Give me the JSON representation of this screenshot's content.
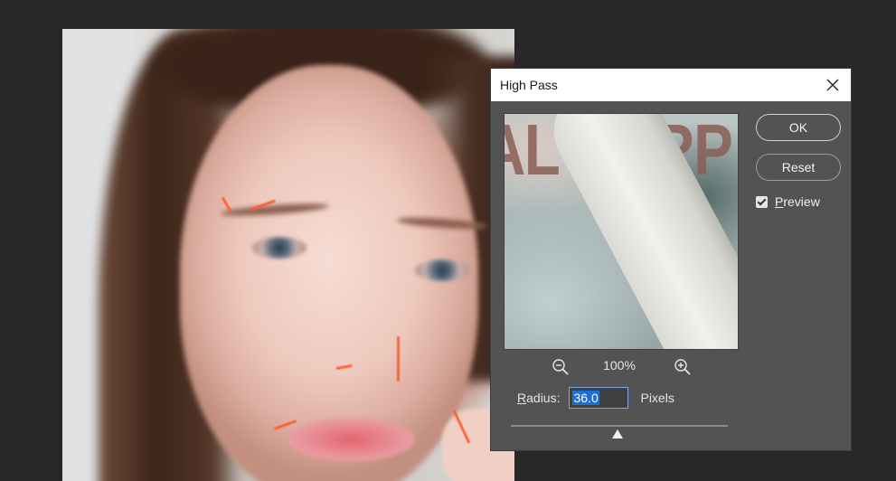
{
  "dialog": {
    "title": "High Pass",
    "close_icon": "close-icon",
    "preview_overlay_text": "AL PURP",
    "zoom": {
      "level": "100%",
      "zoom_out_icon": "zoom-out-icon",
      "zoom_in_icon": "zoom-in-icon"
    },
    "buttons": {
      "ok": "OK",
      "reset": "Reset"
    },
    "preview_checkbox": {
      "label": "Preview",
      "checked": true
    },
    "radius": {
      "label": "Radius:",
      "value": "36.0",
      "unit": "Pixels",
      "slider_fraction": 0.49
    }
  },
  "colors": {
    "app_background": "#282828",
    "dialog_background": "#535353",
    "titlebar": "#ffffff",
    "selection": "#1b6fd6",
    "fringe": "#ff5a2c"
  }
}
